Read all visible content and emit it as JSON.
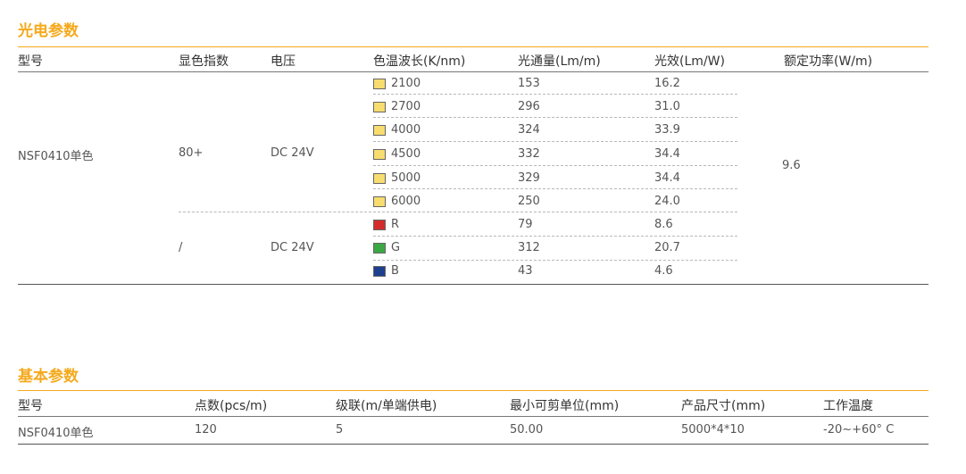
{
  "photo_section": {
    "title": "光电参数",
    "headers": [
      "型号",
      "显色指数",
      "电压",
      "色温波长(K/nm)",
      "光通量(Lm/m)",
      "光效(Lm/W)",
      "额定功率(W/m)"
    ],
    "model": "NSF0410单色",
    "group1": {
      "cri": "80+",
      "voltage": "DC 24V",
      "rows": [
        {
          "cct": "2100",
          "flux": "153",
          "eff": "16.2",
          "swatch": "#F7DC6F"
        },
        {
          "cct": "2700",
          "flux": "296",
          "eff": "31.0",
          "swatch": "#F7DC6F"
        },
        {
          "cct": "4000",
          "flux": "324",
          "eff": "33.9",
          "swatch": "#F7DC6F"
        },
        {
          "cct": "4500",
          "flux": "332",
          "eff": "34.4",
          "swatch": "#F7DC6F"
        },
        {
          "cct": "5000",
          "flux": "329",
          "eff": "34.4",
          "swatch": "#F7DC6F"
        },
        {
          "cct": "6000",
          "flux": "250",
          "eff": "24.0",
          "swatch": "#F7DC6F"
        }
      ]
    },
    "group2": {
      "cri": "/",
      "voltage": "DC 24V",
      "rows": [
        {
          "cct": "R",
          "flux": "79",
          "eff": "8.6",
          "swatch": "#D42A2A"
        },
        {
          "cct": "G",
          "flux": "312",
          "eff": "20.7",
          "swatch": "#3AA845"
        },
        {
          "cct": "B",
          "flux": "43",
          "eff": "4.6",
          "swatch": "#1F3F8F"
        }
      ]
    },
    "power": "9.6"
  },
  "basic_section": {
    "title": "基本参数",
    "headers": [
      "型号",
      "点数(pcs/m)",
      "级联(m/单端供电)",
      "最小可剪单位(mm)",
      "产品尺寸(mm)",
      "工作温度"
    ],
    "values": [
      "NSF0410单色",
      "120",
      "5",
      "50.00",
      "5000*4*10",
      "-20~+60° C"
    ]
  }
}
